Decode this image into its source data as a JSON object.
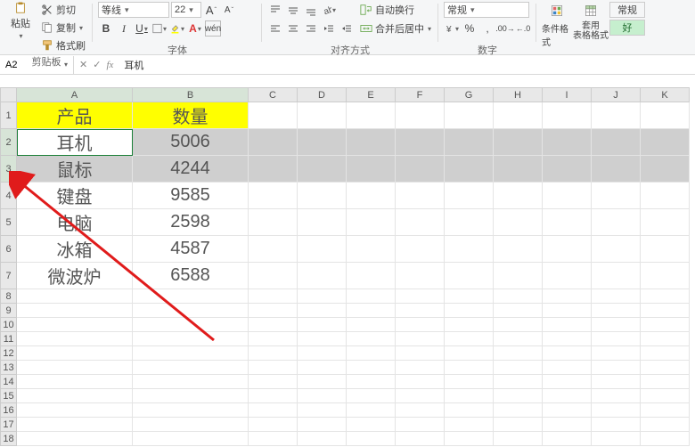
{
  "ribbon": {
    "clipboard": {
      "paste": "粘贴",
      "cut": "剪切",
      "copy": "复制",
      "format_painter": "格式刷",
      "label": "剪贴板"
    },
    "font": {
      "name": "等线",
      "size": "22",
      "increase": "A",
      "decrease": "A",
      "bold": "B",
      "italic": "I",
      "underline": "U",
      "label": "字体"
    },
    "align": {
      "wrap": "自动换行",
      "merge": "合并后居中",
      "label": "对齐方式"
    },
    "number": {
      "format": "常规",
      "label": "数字"
    },
    "styles": {
      "cond": "条件格式",
      "table": "套用\n表格格式",
      "normal": "常规",
      "good": "好"
    }
  },
  "fbar": {
    "name": "A2",
    "fx": "fx",
    "value": "耳机"
  },
  "cols": [
    "A",
    "B",
    "C",
    "D",
    "E",
    "F",
    "G",
    "H",
    "I",
    "J",
    "K"
  ],
  "rows": [
    "1",
    "2",
    "3",
    "4",
    "5",
    "6",
    "7",
    "8",
    "9",
    "10",
    "11",
    "12",
    "13",
    "14",
    "15",
    "16",
    "17",
    "18"
  ],
  "chart_data": {
    "type": "table",
    "title": "",
    "columns": [
      "产品",
      "数量"
    ],
    "data": [
      {
        "产品": "耳机",
        "数量": 5006
      },
      {
        "产品": "鼠标",
        "数量": 4244
      },
      {
        "产品": "键盘",
        "数量": 9585
      },
      {
        "产品": "电脑",
        "数量": 2598
      },
      {
        "产品": "冰箱",
        "数量": 4587
      },
      {
        "产品": "微波炉",
        "数量": 6588
      }
    ],
    "selected_rows": [
      0,
      1
    ],
    "active_cell": "A2"
  }
}
